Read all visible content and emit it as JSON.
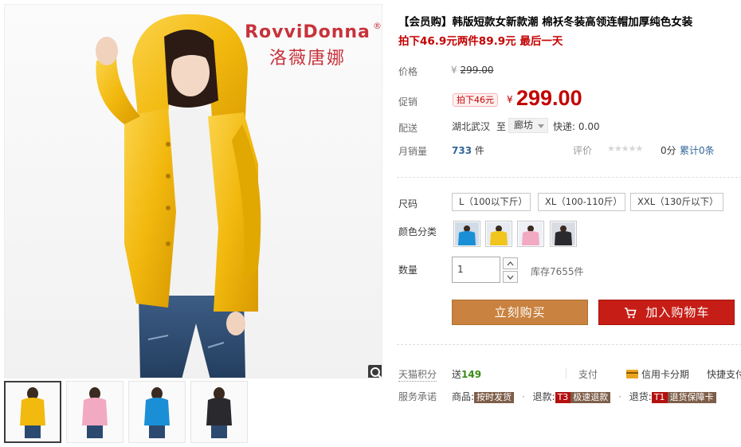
{
  "gallery": {
    "brand_en": "RovviDonna",
    "brand_reg": "®",
    "brand_cn": "洛薇唐娜",
    "thumbnail_count": 4
  },
  "product": {
    "title": "【会员购】韩版短款女新款潮 棉袄冬装高领连帽加厚纯色女装",
    "subtitle": "拍下46.9元两件89.9元 最后一天"
  },
  "price": {
    "label": "价格",
    "currency": "¥",
    "original": "299.00"
  },
  "promo": {
    "label": "促销",
    "tag": "拍下46元",
    "currency": "¥",
    "price": "299.00"
  },
  "shipping": {
    "label": "配送",
    "from": "湖北武汉",
    "to_word": "至",
    "destination": "廊坊",
    "express_label": "快递:",
    "express_fee": "0.00"
  },
  "sales": {
    "label": "月销量",
    "count": "733",
    "unit": "件",
    "rating_label": "评价",
    "stars": "★★★★★",
    "score": "0分",
    "total_reviews": "累计0条"
  },
  "sku": {
    "size_label": "尺码",
    "sizes": [
      "L（100以下斤）",
      "XL（100-110斤）",
      "XXL（130斤以下）"
    ],
    "color_label": "颜色分类",
    "colors": [
      "#1a8fd6",
      "#f0c51e",
      "#f2a9c2",
      "#2a2a2e"
    ],
    "qty_label": "数量",
    "qty_value": "1",
    "stock_text": "库存7655件"
  },
  "actions": {
    "buy_now": "立刻购买",
    "add_cart": "加入购物车"
  },
  "points": {
    "label": "天猫积分",
    "give": "送",
    "amount": "149",
    "pay_label": "支付",
    "credit": "信用卡分期",
    "refund_prefix": "快捷支付"
  },
  "service": {
    "label": "服务承诺",
    "goods_label": "商品:",
    "goods_badge": "按时发货",
    "refund_label": "退款:",
    "refund_t": "T3",
    "refund_badge": "极速退款",
    "return_label": "退货:",
    "return_t": "T1",
    "return_badge": "退货保障卡"
  }
}
